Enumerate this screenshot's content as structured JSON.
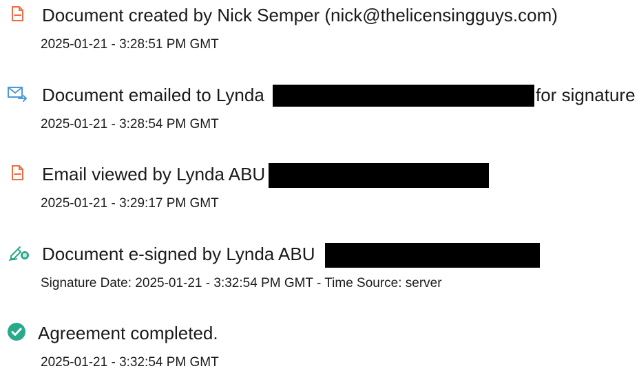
{
  "events": [
    {
      "icon": "document-icon",
      "title": "Document created by Nick Semper (nick@thelicensingguys.com)",
      "meta": "2025-01-21 - 3:28:51 PM GMT"
    },
    {
      "icon": "email-forward-icon",
      "title_prefix": "Document emailed to Lynda",
      "title_suffix": "for signature",
      "meta": "2025-01-21 - 3:28:54 PM GMT"
    },
    {
      "icon": "document-icon",
      "title_prefix": "Email viewed by Lynda ABU",
      "meta": "2025-01-21 - 3:29:17 PM GMT"
    },
    {
      "icon": "e-sign-icon",
      "title_prefix": "Document e-signed by Lynda ABU",
      "meta": "Signature Date: 2025-01-21 - 3:32:54 PM GMT - Time Source: server"
    },
    {
      "icon": "check-circle-icon",
      "title": "Agreement completed.",
      "meta": "2025-01-21 - 3:32:54 PM GMT"
    }
  ],
  "colors": {
    "document_icon": "#ef6c44",
    "email_icon": "#4b9ad7",
    "esign_icon": "#28a88a",
    "check_icon": "#2aa98b",
    "redaction": "#000000"
  }
}
